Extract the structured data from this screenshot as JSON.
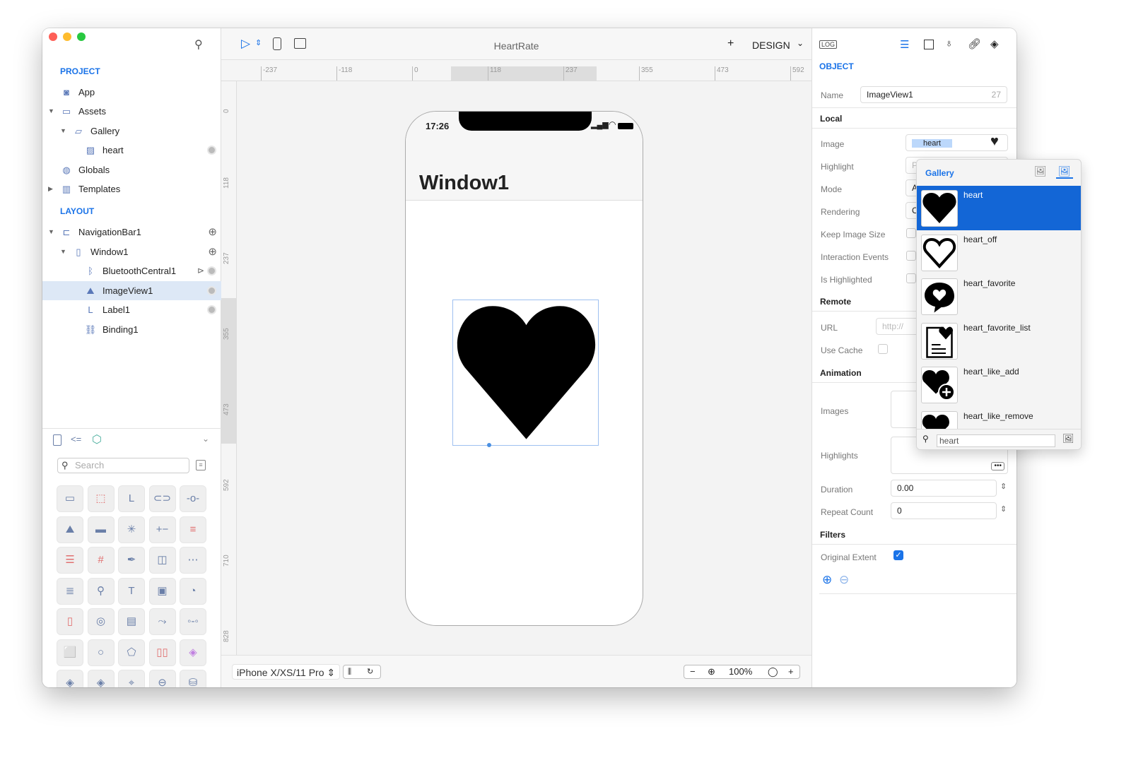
{
  "app_title": "HeartRate",
  "sidebar": {
    "project_label": "PROJECT",
    "layout_label": "LAYOUT",
    "project_items": [
      {
        "label": "App",
        "icon": "app-icon"
      },
      {
        "label": "Assets",
        "icon": "assets-icon",
        "expanded": true
      },
      {
        "label": "Gallery",
        "icon": "folder-icon",
        "expanded": true
      },
      {
        "label": "heart",
        "icon": "image-icon"
      },
      {
        "label": "Globals",
        "icon": "globe-icon"
      },
      {
        "label": "Templates",
        "icon": "templates-icon",
        "expanded": false
      }
    ],
    "layout_items": [
      {
        "label": "NavigationBar1",
        "icon": "navbar-icon"
      },
      {
        "label": "Window1",
        "icon": "window-icon"
      },
      {
        "label": "BluetoothCentral1",
        "icon": "bluetooth-icon"
      },
      {
        "label": "ImageView1",
        "icon": "imageview-icon",
        "selected": true
      },
      {
        "label": "Label1",
        "icon": "label-icon"
      },
      {
        "label": "Binding1",
        "icon": "link-icon"
      }
    ],
    "search_placeholder": "Search",
    "library": [
      "▭",
      "⬚",
      "L",
      "⊂⊃",
      "-o-",
      "⛰",
      "▬",
      "✳",
      "+−",
      "≡",
      "☰",
      "#",
      "✒",
      "◫",
      "⋯",
      "≣",
      "⚲",
      "T",
      "▣",
      "◔",
      "▯",
      "◎",
      "▤",
      "⤳",
      "◦-◦",
      "⬜",
      "○",
      "⬠",
      "▯▯",
      "◈",
      "◈",
      "◈",
      "⌖",
      "⊖",
      "⛁"
    ]
  },
  "toolbar": {
    "add": "+",
    "mode": "DESIGN"
  },
  "ruler": {
    "top": [
      "-237",
      "-118",
      "0",
      "118",
      "237",
      "355",
      "473",
      "592"
    ],
    "left": [
      "0",
      "118",
      "237",
      "355",
      "473",
      "592",
      "710",
      "828"
    ]
  },
  "phone": {
    "time": "17:26",
    "title": "Window1"
  },
  "bottom": {
    "device": "iPhone X/XS/11 Pro",
    "zoom": "100%",
    "minus": "−",
    "plus": "+"
  },
  "inspector": {
    "log": "LOG",
    "object_label": "OBJECT",
    "name_label": "Name",
    "name_value": "ImageView1",
    "name_count": "27",
    "local": "Local",
    "image_label": "Image",
    "image_value": "heart",
    "highlight_label": "Highlight",
    "highlight_value": "P",
    "mode_label": "Mode",
    "mode_value": "A",
    "rendering_label": "Rendering",
    "rendering_value": "O",
    "keep_label": "Keep Image Size",
    "interaction_label": "Interaction Events",
    "highlighted_label": "Is Highlighted",
    "remote": "Remote",
    "url_label": "URL",
    "url_placeholder": "http://",
    "cache_label": "Use Cache",
    "animation": "Animation",
    "images_label": "Images",
    "highlights_label": "Highlights",
    "duration_label": "Duration",
    "duration_value": "0.00",
    "repeat_label": "Repeat Count",
    "repeat_value": "0",
    "filters": "Filters",
    "extent_label": "Original Extent",
    "extent_checked": true
  },
  "gallery": {
    "title": "Gallery",
    "items": [
      {
        "name": "heart",
        "selected": true
      },
      {
        "name": "heart_off"
      },
      {
        "name": "heart_favorite"
      },
      {
        "name": "heart_favorite_list"
      },
      {
        "name": "heart_like_add"
      },
      {
        "name": "heart_like_remove"
      }
    ],
    "search_value": "heart"
  },
  "colors": {
    "accent": "#1a73e8",
    "selection": "#1366d6"
  }
}
